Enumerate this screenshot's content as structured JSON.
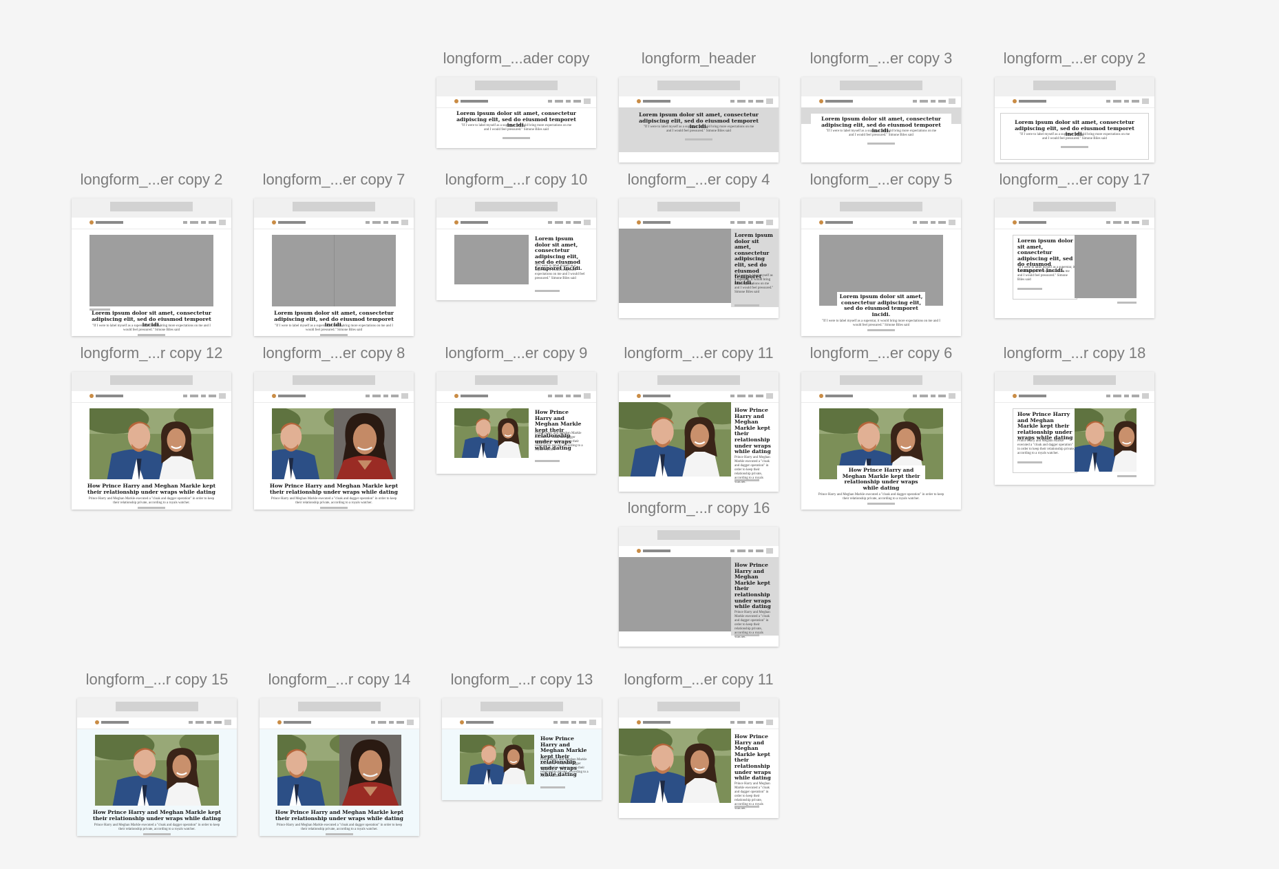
{
  "artboard_title_long": "Lorem ipsum dolor sit amet, consectetur adipiscing elit, sed do eiusmod temporet incidi.",
  "artboard_title_harry": "How Prince Harry and Meghan Markle kept their relationship under wraps while dating",
  "artboard_dek_quote": "\"If I were to label myself as a superstar, it would bring more expectations on me and I would feel pressured.\" Simone Biles said",
  "artboard_dek_harry": "Prince Harry and Meghan Markle executed a \"cloak and dagger operation\" in order to keep their relationship private, according to a royals watcher.",
  "colors": {
    "canvas": "#f5f5f5",
    "label": "#7b7b7b",
    "placeholder": "#9e9e9e",
    "gray_panel": "#d9d9d9",
    "tint": "#f1f9fc",
    "accent_logo": "#c98c45"
  },
  "artboards": [
    {
      "label": "longform_...ader copy",
      "variant": "text-only",
      "content": "lorem"
    },
    {
      "label": "longform_header",
      "variant": "gray-band",
      "content": "lorem"
    },
    {
      "label": "longform_...er copy 3",
      "variant": "white-card-on-gray",
      "content": "lorem"
    },
    {
      "label": "longform_...er copy 2",
      "variant": "outlined-box",
      "content": "lorem"
    },
    {
      "label": "longform_...er copy 2",
      "variant": "image-top",
      "content": "lorem",
      "image": "placeholder"
    },
    {
      "label": "longform_...er copy 7",
      "variant": "image-top-split",
      "content": "lorem",
      "image": "placeholder"
    },
    {
      "label": "longform_...r copy 10",
      "variant": "image-left",
      "content": "lorem",
      "image": "placeholder"
    },
    {
      "label": "longform_...er copy 4",
      "variant": "image-full-panel",
      "content": "lorem",
      "image": "placeholder"
    },
    {
      "label": "longform_...er copy 5",
      "variant": "image-card-overlap",
      "content": "lorem",
      "image": "placeholder"
    },
    {
      "label": "longform_...er copy 17",
      "variant": "card-image-right",
      "content": "lorem",
      "image": "placeholder"
    },
    {
      "label": "longform_...r copy 12",
      "variant": "image-top",
      "content": "harry",
      "image": "couple-photo"
    },
    {
      "label": "longform_...er copy 8",
      "variant": "image-top-split",
      "content": "harry",
      "image": "couple-photo"
    },
    {
      "label": "longform_...er copy 9",
      "variant": "image-left",
      "content": "harry",
      "image": "couple-photo"
    },
    {
      "label": "longform_...er copy 11",
      "variant": "image-full-panel",
      "content": "harry",
      "image": "couple-photo"
    },
    {
      "label": "longform_...er copy 6",
      "variant": "image-card-overlap",
      "content": "harry",
      "image": "couple-photo"
    },
    {
      "label": "longform_...r copy 18",
      "variant": "card-image-right",
      "content": "harry",
      "image": "couple-photo"
    },
    {
      "label": "longform_...r copy 16",
      "variant": "image-full-panel",
      "content": "harry",
      "image": "placeholder"
    },
    {
      "label": "longform_...r copy 15",
      "variant": "image-top",
      "content": "harry",
      "image": "couple-photo",
      "tint": true
    },
    {
      "label": "longform_...r copy 14",
      "variant": "image-top-split",
      "content": "harry",
      "image": "couple-photo",
      "tint": true
    },
    {
      "label": "longform_...r copy 13",
      "variant": "image-left",
      "content": "harry",
      "image": "couple-photo",
      "tint": true
    },
    {
      "label": "longform_...er copy 11",
      "variant": "image-full-panel",
      "content": "harry",
      "image": "couple-photo"
    }
  ]
}
